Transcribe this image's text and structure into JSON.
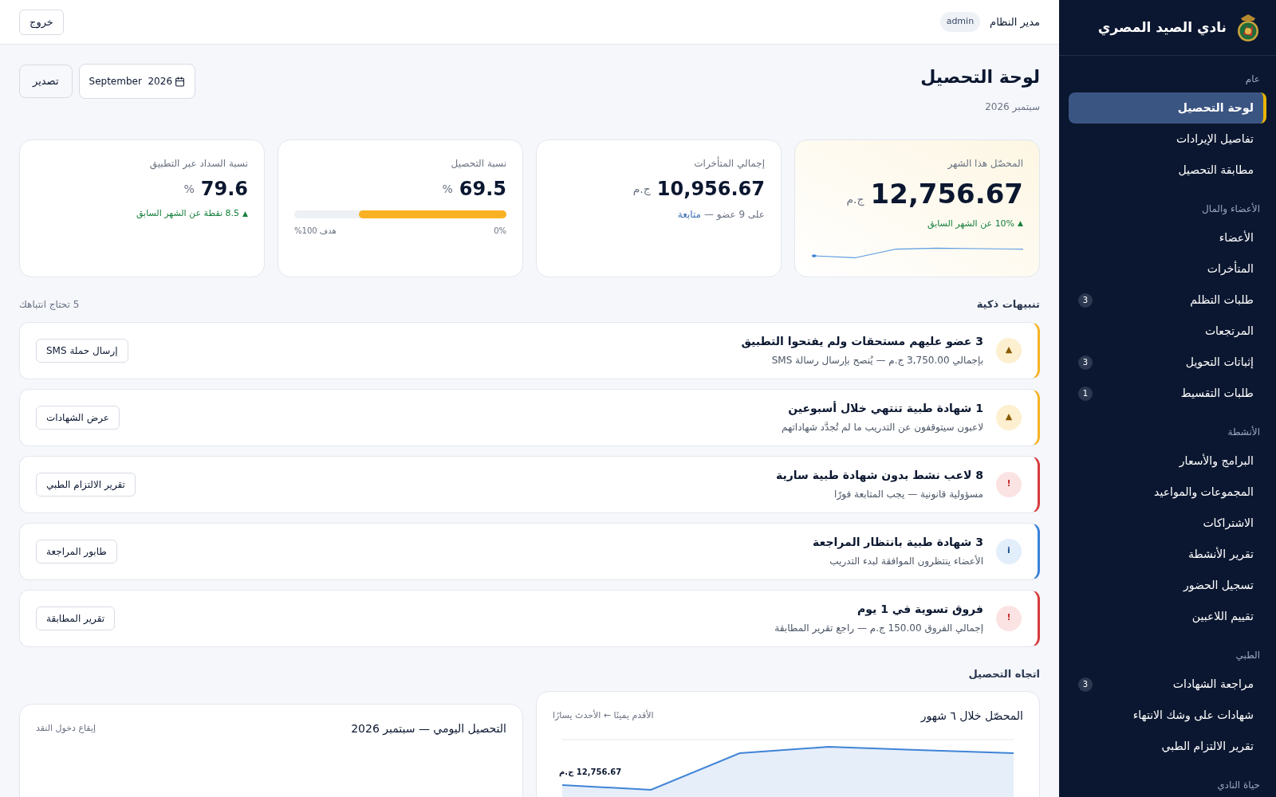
{
  "sidebar": {
    "title": "نادي الصيد المصري",
    "sections": [
      {
        "label": "عام",
        "items": [
          {
            "label": "لوحة التحصيل",
            "selected": true
          },
          {
            "label": "تفاصيل الإيرادات",
            "selected": false
          },
          {
            "label": "مطابقة التحصيل",
            "selected": false
          }
        ]
      },
      {
        "label": "الأعضاء والمال",
        "items": [
          {
            "label": "الأعضاء",
            "selected": false
          },
          {
            "label": "المتأخرات",
            "selected": false
          },
          {
            "label": "طلبات التظلم",
            "selected": false,
            "badge": "3"
          },
          {
            "label": "المرتجعات",
            "selected": false
          },
          {
            "label": "إثباتات التحويل",
            "selected": false,
            "badge": "3"
          },
          {
            "label": "طلبات التقسيط",
            "selected": false,
            "badge": "1"
          }
        ]
      },
      {
        "label": "الأنشطة",
        "items": [
          {
            "label": "البرامج والأسعار",
            "selected": false
          },
          {
            "label": "المجموعات والمواعيد",
            "selected": false
          },
          {
            "label": "الاشتراكات",
            "selected": false
          },
          {
            "label": "تقرير الأنشطة",
            "selected": false
          },
          {
            "label": "تسجيل الحضور",
            "selected": false
          },
          {
            "label": "تقييم اللاعبين",
            "selected": false
          }
        ]
      },
      {
        "label": "الطبي",
        "items": [
          {
            "label": "مراجعة الشهادات",
            "selected": false,
            "badge": "3"
          },
          {
            "label": "شهادات على وشك الانتهاء",
            "selected": false
          },
          {
            "label": "تقرير الالتزام الطبي",
            "selected": false
          }
        ]
      },
      {
        "label": "حياة النادي"
      }
    ]
  },
  "topbar": {
    "user": "مدير النظام",
    "role": "admin",
    "logout": "خروج"
  },
  "page": {
    "title": "لوحة التحصيل",
    "subtitle": "سبتمبر 2026",
    "month_value": "September  2026",
    "export": "تصدير"
  },
  "stats": [
    {
      "kind": "sparkline",
      "label": "المحصّل هذا الشهر",
      "value": "12,756.67",
      "unit": "ج.م",
      "arrow": "▲",
      "delta": "10% عن الشهر السابق"
    },
    {
      "kind": "link",
      "label": "إجمالي المتأخرات",
      "value": "10,956.67",
      "unit": "ج.م",
      "note": "على 9 عضو —",
      "link": "متابعة"
    },
    {
      "kind": "progress",
      "label": "نسبة التحصيل",
      "value": "69.5",
      "unit": "%",
      "level": 0.695,
      "start": "0%",
      "target": "هدف 100%"
    },
    {
      "kind": "delta",
      "label": "نسبة السداد عبر التطبيق",
      "value": "79.6",
      "unit": "%",
      "arrow": "▲",
      "delta": "8.5 نقطة عن الشهر السابق"
    }
  ],
  "alerts": {
    "title": "تنبيهات ذكية",
    "count": "5 تحتاج انتباهك",
    "items": [
      {
        "kind": "warning",
        "icon": "▲",
        "title": "3 عضو عليهم مستحقات ولم يفتحوا التطبيق",
        "detail": "بإجمالي 3,750.00 ج.م — يُنصح بإرسال رسالة SMS",
        "action": "إرسال حملة SMS"
      },
      {
        "kind": "warning",
        "icon": "▲",
        "title": "1 شهادة طبية تنتهي خلال أسبوعين",
        "detail": "لاعبون سيتوقفون عن التدريب ما لم تُجدَّد شهاداتهم",
        "action": "عرض الشهادات"
      },
      {
        "kind": "danger",
        "icon": "!",
        "title": "8 لاعب نشط بدون شهادة طبية سارية",
        "detail": "مسؤولية قانونية — يجب المتابعة فورًا",
        "action": "تقرير الالتزام الطبي"
      },
      {
        "kind": "info",
        "icon": "i",
        "title": "3 شهادة طبية بانتظار المراجعة",
        "detail": "الأعضاء ينتظرون الموافقة لبدء التدريب",
        "action": "طابور المراجعة"
      },
      {
        "kind": "danger",
        "icon": "!",
        "title": "فروق تسوية في 1 يوم",
        "detail": "إجمالي الفروق 150.00 ج.م — راجع تقرير المطابقة",
        "action": "تقرير المطابقة"
      }
    ]
  },
  "trend": {
    "title": "اتجاه التحصيل",
    "cards": [
      {
        "title": "المحصّل خلال ٦ شهور",
        "hint": "الأقدم يمينًا ← الأحدث يسارًا",
        "point_label": "12,756.67 ج.م"
      },
      {
        "title": "التحصيل اليومي — سبتمبر 2026",
        "hint": "إيقاع دخول النقد"
      }
    ]
  }
}
